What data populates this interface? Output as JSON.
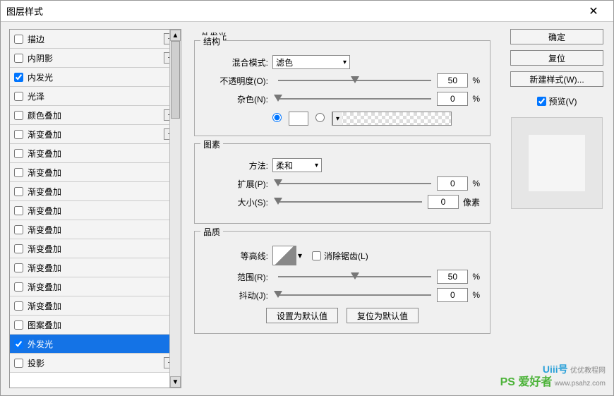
{
  "window": {
    "title": "图层样式"
  },
  "sidebar": {
    "items": [
      {
        "label": "描边",
        "checked": false,
        "hasPlus": true
      },
      {
        "label": "内阴影",
        "checked": false,
        "hasPlus": true
      },
      {
        "label": "内发光",
        "checked": true,
        "hasPlus": false
      },
      {
        "label": "光泽",
        "checked": false,
        "hasPlus": false
      },
      {
        "label": "颜色叠加",
        "checked": false,
        "hasPlus": true
      },
      {
        "label": "渐变叠加",
        "checked": false,
        "hasPlus": true
      },
      {
        "label": "渐变叠加",
        "checked": false,
        "hasPlus": false
      },
      {
        "label": "渐变叠加",
        "checked": false,
        "hasPlus": false
      },
      {
        "label": "渐变叠加",
        "checked": false,
        "hasPlus": false
      },
      {
        "label": "渐变叠加",
        "checked": false,
        "hasPlus": false
      },
      {
        "label": "渐变叠加",
        "checked": false,
        "hasPlus": false
      },
      {
        "label": "渐变叠加",
        "checked": false,
        "hasPlus": false
      },
      {
        "label": "渐变叠加",
        "checked": false,
        "hasPlus": false
      },
      {
        "label": "渐变叠加",
        "checked": false,
        "hasPlus": false
      },
      {
        "label": "渐变叠加",
        "checked": false,
        "hasPlus": false
      },
      {
        "label": "图案叠加",
        "checked": false,
        "hasPlus": false
      },
      {
        "label": "外发光",
        "checked": true,
        "hasPlus": false,
        "selected": true
      },
      {
        "label": "投影",
        "checked": false,
        "hasPlus": true
      }
    ]
  },
  "panel": {
    "title": "外发光",
    "groups": {
      "structure": {
        "legend": "结构",
        "blend_label": "混合模式:",
        "blend_value": "滤色",
        "opacity_label": "不透明度(O):",
        "opacity_value": "50",
        "opacity_unit": "%",
        "noise_label": "杂色(N):",
        "noise_value": "0",
        "noise_unit": "%"
      },
      "elements": {
        "legend": "图素",
        "technique_label": "方法:",
        "technique_value": "柔和",
        "spread_label": "扩展(P):",
        "spread_value": "0",
        "spread_unit": "%",
        "size_label": "大小(S):",
        "size_value": "0",
        "size_unit": "像素"
      },
      "quality": {
        "legend": "品质",
        "contour_label": "等高线:",
        "antialias_label": "消除锯齿(L)",
        "range_label": "范围(R):",
        "range_value": "50",
        "range_unit": "%",
        "jitter_label": "抖动(J):",
        "jitter_value": "0",
        "jitter_unit": "%"
      }
    },
    "buttons": {
      "default": "设置为默认值",
      "reset": "复位为默认值"
    }
  },
  "right": {
    "ok": "确定",
    "cancel": "复位",
    "newstyle": "新建样式(W)...",
    "preview": "预览(V)"
  },
  "watermark": {
    "line1": "Uiii号",
    "line1sub": "优优教程网",
    "line2": "PS 爱好者",
    "line2sub": "www.psahz.com"
  }
}
